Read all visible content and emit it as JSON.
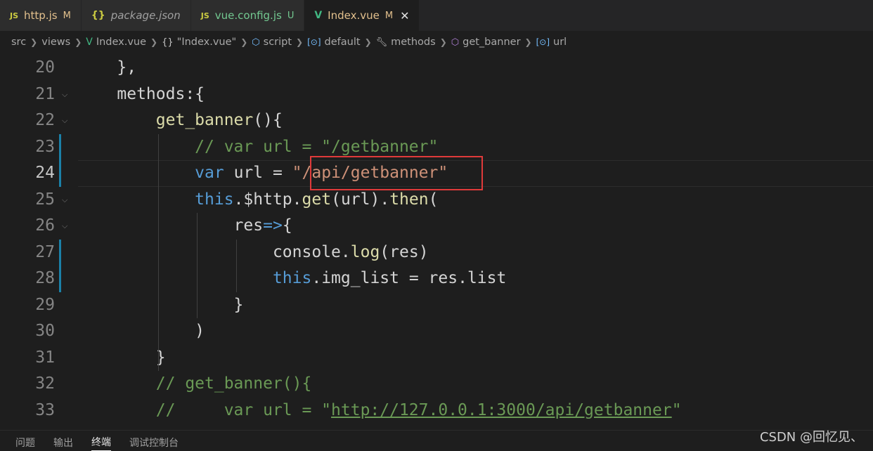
{
  "tabs": [
    {
      "icon": "JS",
      "label": "http.js",
      "badge": "M"
    },
    {
      "icon": "{}",
      "label": "package.json",
      "badge": ""
    },
    {
      "icon": "JS",
      "label": "vue.config.js",
      "badge": "U"
    },
    {
      "icon": "V",
      "label": "Index.vue",
      "badge": "M",
      "close": "✕"
    }
  ],
  "breadcrumb": {
    "items": [
      {
        "label": "src",
        "icon": ""
      },
      {
        "label": "views",
        "icon": ""
      },
      {
        "label": "Index.vue",
        "icon": "V"
      },
      {
        "label": "\"Index.vue\"",
        "icon": "{}"
      },
      {
        "label": "script",
        "icon": "cube-icon"
      },
      {
        "label": "default",
        "icon": "variable-icon"
      },
      {
        "label": "methods",
        "icon": "wrench-icon"
      },
      {
        "label": "get_banner",
        "icon": "method-icon"
      },
      {
        "label": "url",
        "icon": "variable-icon"
      }
    ]
  },
  "editor": {
    "current_line": 24,
    "highlight_text": "\"/api/getbanner\"",
    "lines": [
      {
        "number": "20",
        "text": "    },"
      },
      {
        "number": "21",
        "text": "    methods:{"
      },
      {
        "number": "22",
        "text": "        get_banner(){"
      },
      {
        "number": "23",
        "text": "            // var url = \"/getbanner\""
      },
      {
        "number": "24",
        "text": "            var url = \"/api/getbanner\""
      },
      {
        "number": "25",
        "text": "            this.$http.get(url).then("
      },
      {
        "number": "26",
        "text": "                res=>{"
      },
      {
        "number": "27",
        "text": "                    console.log(res)"
      },
      {
        "number": "28",
        "text": "                    this.img_list = res.list"
      },
      {
        "number": "29",
        "text": "                }"
      },
      {
        "number": "30",
        "text": "            )"
      },
      {
        "number": "31",
        "text": "        }"
      },
      {
        "number": "32",
        "text": "        // get_banner(){"
      },
      {
        "number": "33",
        "text": "        //     var url = \"http://127.0.0.1:3000/api/getbanner\""
      }
    ]
  },
  "panel": {
    "tabs": [
      "问题",
      "输出",
      "终端",
      "调试控制台"
    ],
    "active": "终端"
  },
  "watermark": "CSDN @回忆见、"
}
